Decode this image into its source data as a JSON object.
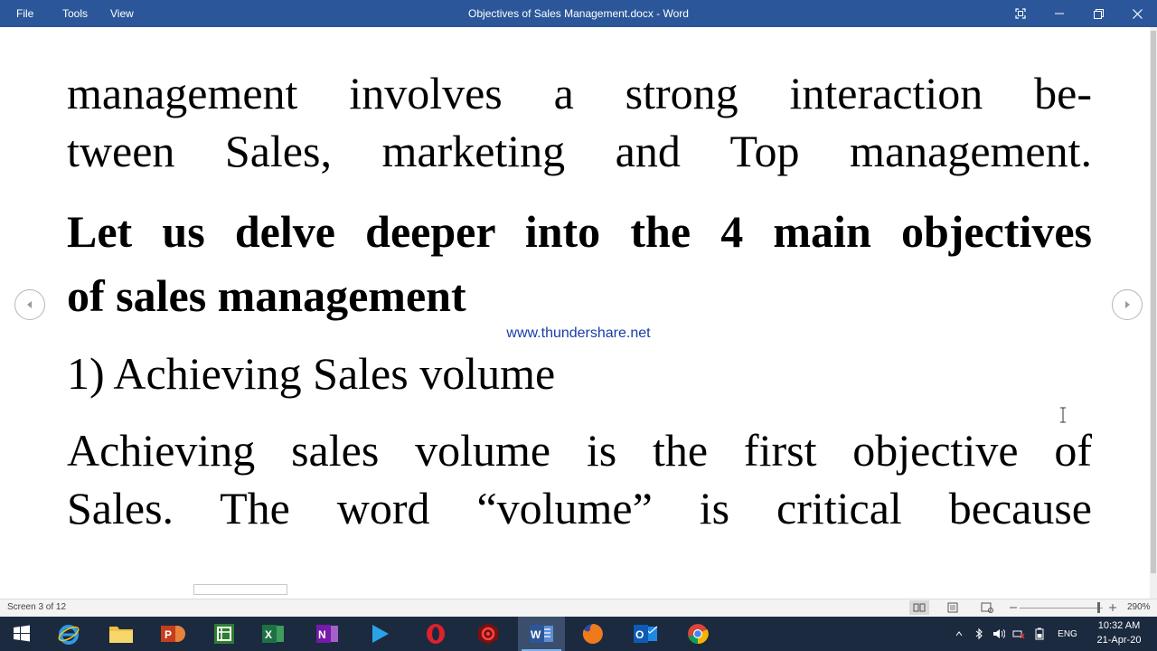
{
  "titlebar": {
    "menus": [
      "File",
      "Tools",
      "View"
    ],
    "title": "Objectives of Sales Management.docx  -  Word"
  },
  "document": {
    "line1": "management involves a strong interaction be-",
    "line2": "tween Sales, marketing and Top management.",
    "heading_line1": "Let us delve deeper into the 4 main objectives",
    "heading_line2": "of sales management",
    "watermark": "www.thundershare.net",
    "subheading": "1) Achieving Sales volume",
    "para_line1": "Achieving sales volume is the first objective of",
    "para_line2": "Sales. The word “volume” is critical because"
  },
  "statusbar": {
    "page_status": "Screen 3 of 12",
    "zoom": "290%"
  },
  "taskbar": {
    "apps": [
      "windows-start",
      "internet-explorer",
      "file-explorer",
      "powerpoint",
      "project",
      "excel",
      "onenote",
      "media-player",
      "opera",
      "app-red",
      "word",
      "firefox",
      "outlook",
      "chrome"
    ],
    "language": "ENG",
    "time": "10:32 AM",
    "date": "21-Apr-20"
  },
  "colors": {
    "titlebar": "#2b579a",
    "taskbar": "#1b2a3f",
    "watermark": "#1a3da6"
  }
}
